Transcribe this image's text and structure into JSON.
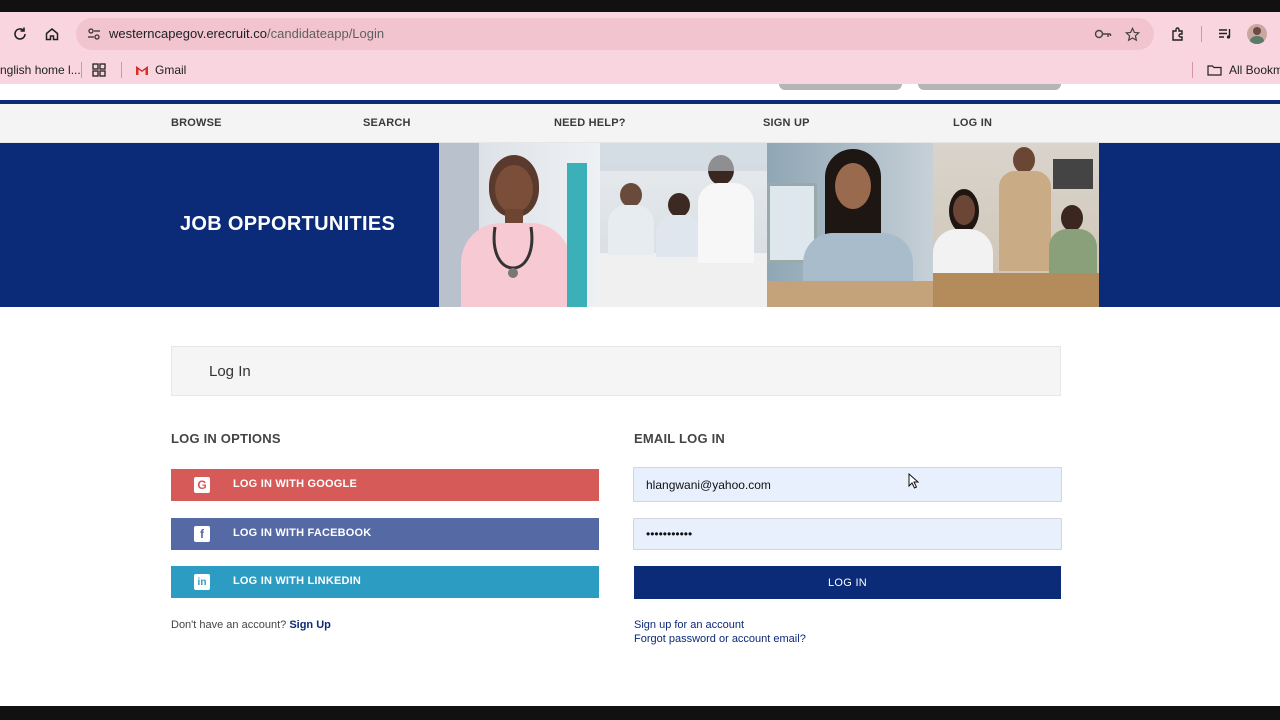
{
  "browser": {
    "url_domain": "westerncapegov.erecruit.co",
    "url_path": "/candidateapp/Login",
    "bookmarks": [
      {
        "label": "nglish home l..."
      },
      {
        "label": "Gmail"
      }
    ],
    "all_bookmarks_label": "All Bookma"
  },
  "nav": {
    "items": [
      "BROWSE",
      "SEARCH",
      "NEED HELP?",
      "SIGN UP",
      "LOG IN"
    ]
  },
  "banner": {
    "title": "JOB OPPORTUNITIES"
  },
  "login": {
    "heading": "Log In",
    "options_title": "LOG IN OPTIONS",
    "email_title": "EMAIL LOG IN",
    "google_label": "LOG IN WITH GOOGLE",
    "facebook_label": "LOG IN WITH FACEBOOK",
    "linkedin_label": "LOG IN WITH LINKEDIN",
    "no_account_text": "Don't have an account?",
    "sign_up_link": "Sign Up",
    "email_value": "hlangwani@yahoo.com",
    "password_value": "•••••••••••",
    "login_button": "LOG IN",
    "signup_account_link": "Sign up for an account",
    "forgot_link": "Forgot password or account email?"
  },
  "colors": {
    "brand_blue": "#0b2a78",
    "google_red": "#d65a57",
    "facebook_blue": "#556aa4",
    "linkedin_blue": "#2d9cc3"
  },
  "icons": [
    "reload-icon",
    "home-icon",
    "site-settings-icon",
    "password-key-icon",
    "bookmark-star-icon",
    "extensions-icon",
    "media-icon",
    "profile-avatar",
    "apps-grid-icon",
    "gmail-icon",
    "folder-icon",
    "google-icon",
    "facebook-icon",
    "linkedin-icon",
    "mouse-cursor"
  ]
}
